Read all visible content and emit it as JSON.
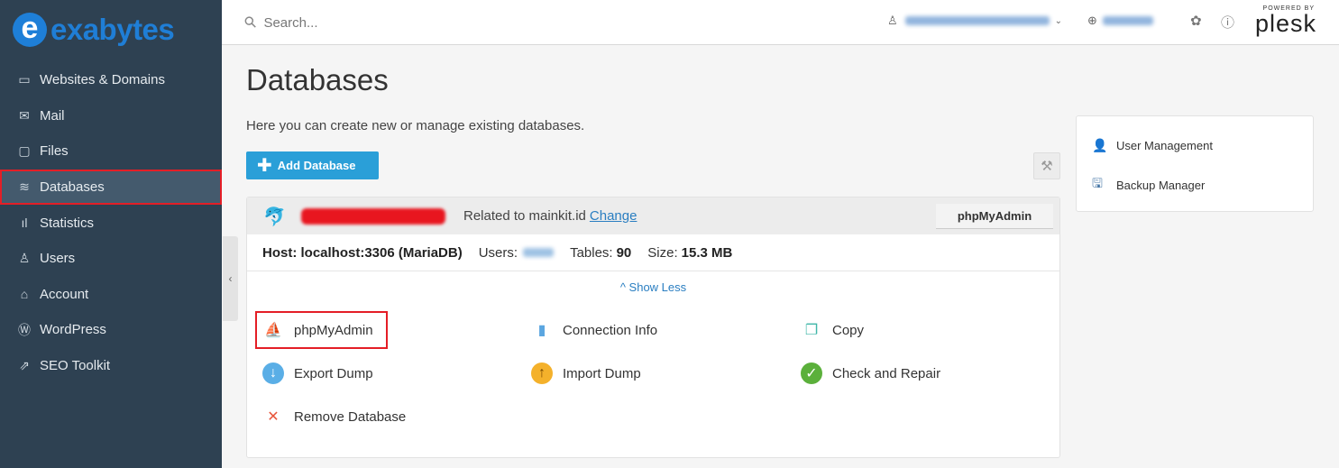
{
  "brand": {
    "logo_letter": "e",
    "logo_name": "exabytes"
  },
  "search": {
    "placeholder": "Search..."
  },
  "topbar": {
    "powered_by": "POWERED BY",
    "plesk": "plesk"
  },
  "sidebar": {
    "items": [
      {
        "label": "Websites & Domains",
        "icon": "monitor-icon"
      },
      {
        "label": "Mail",
        "icon": "mail-icon"
      },
      {
        "label": "Files",
        "icon": "folder-icon"
      },
      {
        "label": "Databases",
        "icon": "database-icon",
        "active": true
      },
      {
        "label": "Statistics",
        "icon": "statistics-icon"
      },
      {
        "label": "Users",
        "icon": "user-icon"
      },
      {
        "label": "Account",
        "icon": "account-icon"
      },
      {
        "label": "WordPress",
        "icon": "wordpress-icon"
      },
      {
        "label": "SEO Toolkit",
        "icon": "seo-icon"
      }
    ]
  },
  "page": {
    "title": "Databases",
    "intro": "Here you can create new or manage existing databases.",
    "add_button": "Add Database"
  },
  "database": {
    "related_prefix": "Related to mainkit.id",
    "change_link": "Change",
    "phpmyadmin_button": "phpMyAdmin",
    "host_label": "Host: localhost:3306 (MariaDB)",
    "users_label": "Users:",
    "tables_label": "Tables:",
    "tables_value": "90",
    "size_label": "Size:",
    "size_value": "15.3 MB",
    "show_less": "^ Show Less",
    "actions": {
      "phpmyadmin": "phpMyAdmin",
      "connection_info": "Connection Info",
      "copy": "Copy",
      "export_dump": "Export Dump",
      "import_dump": "Import Dump",
      "check_repair": "Check and Repair",
      "remove": "Remove Database"
    }
  },
  "side_panel": {
    "user_management": "User Management",
    "backup_manager": "Backup Manager"
  },
  "colors": {
    "sidebar_bg": "#2e4152",
    "accent": "#2a9fd8",
    "highlight": "#e41e26"
  }
}
